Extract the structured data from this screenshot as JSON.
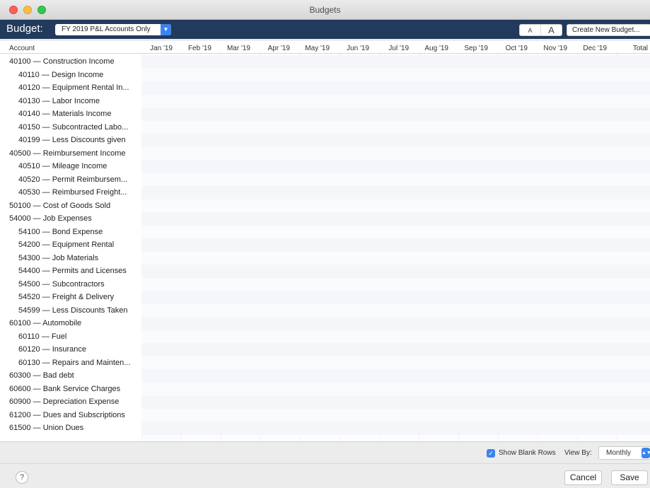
{
  "window": {
    "title": "Budgets"
  },
  "budget_bar": {
    "label": "Budget:",
    "selected_budget": "FY 2019 P&L Accounts Only",
    "font_small": "A",
    "font_large": "A",
    "create_button": "Create New Budget..."
  },
  "table": {
    "account_header": "Account",
    "months": [
      "Jan '19",
      "Feb '19",
      "Mar '19",
      "Apr '19",
      "May '19",
      "Jun '19",
      "Jul '19",
      "Aug '19",
      "Sep '19",
      "Oct '19",
      "Nov '19",
      "Dec '19",
      "Total"
    ],
    "rows": [
      {
        "label": "40100 — Construction Income",
        "level": 0
      },
      {
        "label": "40110 — Design Income",
        "level": 1
      },
      {
        "label": "40120 — Equipment Rental In...",
        "level": 1
      },
      {
        "label": "40130 — Labor Income",
        "level": 1
      },
      {
        "label": "40140 — Materials Income",
        "level": 1
      },
      {
        "label": "40150 — Subcontracted Labo...",
        "level": 1
      },
      {
        "label": "40199 — Less Discounts given",
        "level": 1
      },
      {
        "label": "40500 — Reimbursement Income",
        "level": 0
      },
      {
        "label": "40510 — Mileage Income",
        "level": 1
      },
      {
        "label": "40520 — Permit Reimbursem...",
        "level": 1
      },
      {
        "label": "40530 — Reimbursed Freight...",
        "level": 1
      },
      {
        "label": "50100 — Cost of Goods Sold",
        "level": 0
      },
      {
        "label": "54000 — Job Expenses",
        "level": 0
      },
      {
        "label": "54100 — Bond Expense",
        "level": 1
      },
      {
        "label": "54200 — Equipment Rental",
        "level": 1
      },
      {
        "label": "54300 — Job Materials",
        "level": 1
      },
      {
        "label": "54400 — Permits and Licenses",
        "level": 1
      },
      {
        "label": "54500 — Subcontractors",
        "level": 1
      },
      {
        "label": "54520 — Freight & Delivery",
        "level": 1
      },
      {
        "label": "54599 — Less Discounts Taken",
        "level": 1
      },
      {
        "label": "60100 — Automobile",
        "level": 0
      },
      {
        "label": "60110 — Fuel",
        "level": 1
      },
      {
        "label": "60120 — Insurance",
        "level": 1
      },
      {
        "label": "60130 — Repairs and Mainten...",
        "level": 1
      },
      {
        "label": "60300 — Bad debt",
        "level": 0
      },
      {
        "label": "60600 — Bank Service Charges",
        "level": 0
      },
      {
        "label": "60900 — Depreciation Expense",
        "level": 0
      },
      {
        "label": "61200 — Dues and Subscriptions",
        "level": 0
      },
      {
        "label": "61500 — Union Dues",
        "level": 0
      },
      {
        "label": "",
        "level": 0
      }
    ]
  },
  "footer": {
    "show_blank_rows_label": "Show Blank Rows",
    "show_blank_rows_checked": true,
    "view_by_label": "View By:",
    "view_by_value": "Monthly",
    "help_label": "?",
    "cancel_label": "Cancel",
    "save_label": "Save"
  },
  "colors": {
    "budget_bar": "#223a5c",
    "accent": "#3b84f0"
  }
}
